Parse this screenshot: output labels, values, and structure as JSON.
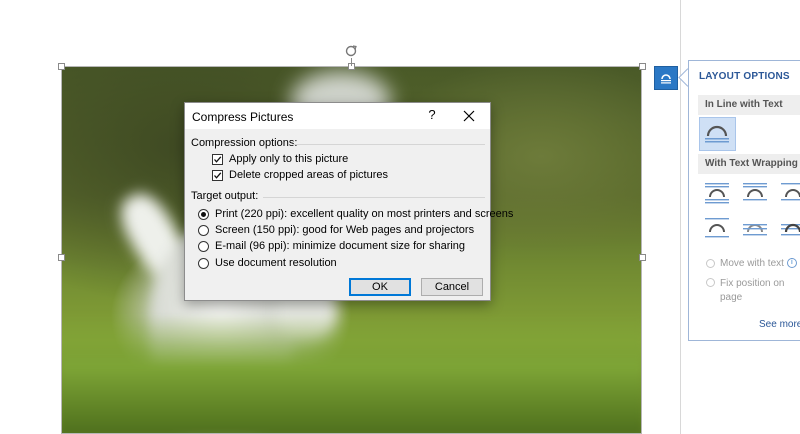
{
  "dialog": {
    "title": "Compress Pictures",
    "help_label": "?",
    "compression_section": "Compression options:",
    "apply_only_label": "Apply only to this picture",
    "apply_only_checked": true,
    "delete_cropped_label": "Delete cropped areas of pictures",
    "delete_cropped_checked": true,
    "target_section": "Target output:",
    "targets": [
      {
        "label": "Print (220 ppi): excellent quality on most printers and screens",
        "selected": true
      },
      {
        "label": "Screen (150 ppi): good for Web pages and projectors",
        "selected": false
      },
      {
        "label": "E-mail (96 ppi): minimize document size for sharing",
        "selected": false
      },
      {
        "label": "Use document resolution",
        "selected": false
      }
    ],
    "ok_label": "OK",
    "cancel_label": "Cancel"
  },
  "layout_pane": {
    "title": "LAYOUT OPTIONS",
    "inline_section": "In Line with Text",
    "wrapping_section": "With Text Wrapping",
    "move_with_text": "Move with text",
    "fix_position": "Fix position on",
    "fix_position_2": "page",
    "see_more": "See more"
  },
  "icons": {
    "rotate": "rotate-handle-icon",
    "layout_options": "layout-options-icon",
    "close": "close-icon",
    "info": "info-icon"
  },
  "colors": {
    "accent": "#2b78c5",
    "pane_title": "#2b5797",
    "default_button_border": "#0078d7"
  }
}
